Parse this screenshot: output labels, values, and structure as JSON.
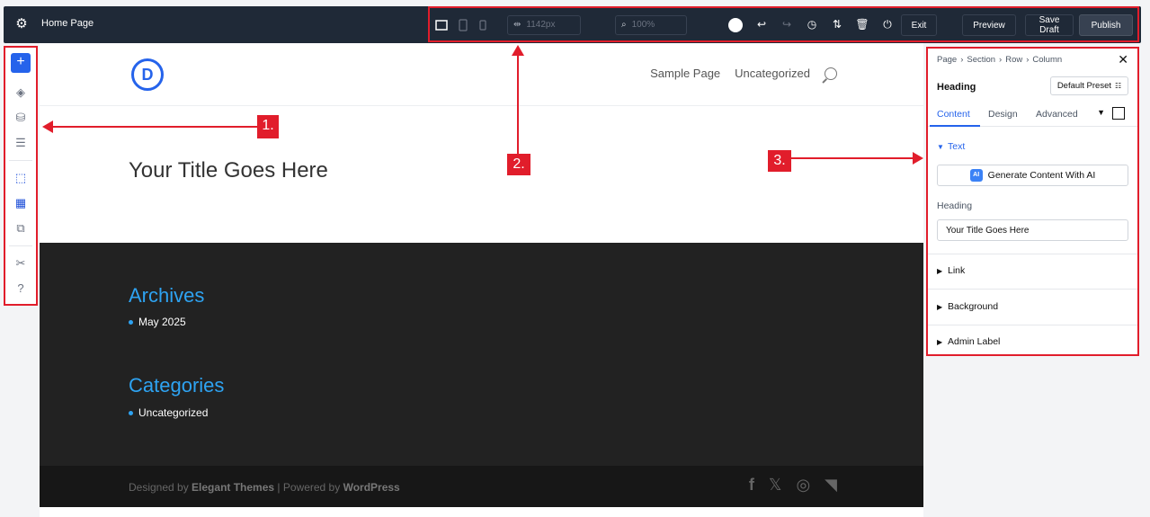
{
  "topbar": {
    "page_name": "Home Page",
    "width_value": "1142px",
    "zoom_value": "100%",
    "exit_label": "Exit",
    "preview_label": "Preview",
    "save_draft_line1": "Save",
    "save_draft_line2": "Draft",
    "publish_label": "Publish"
  },
  "site": {
    "logo_letter": "D",
    "nav": [
      "Sample Page",
      "Uncategorized"
    ],
    "title": "Your Title Goes Here",
    "archives_heading": "Archives",
    "archives_items": [
      "May 2025"
    ],
    "categories_heading": "Categories",
    "categories_items": [
      "Uncategorized"
    ],
    "footer_prefix": "Designed by ",
    "footer_brand": "Elegant Themes",
    "footer_mid": " | Powered by ",
    "footer_wp": "WordPress"
  },
  "panel": {
    "breadcrumb": [
      "Page",
      "Section",
      "Row",
      "Column"
    ],
    "module_name": "Heading",
    "preset_label": "Default Preset",
    "tabs": [
      "Content",
      "Design",
      "Advanced"
    ],
    "text_section": "Text",
    "generate_label": "Generate Content With AI",
    "ai_badge": "AI",
    "heading_label": "Heading",
    "heading_value": "Your Title Goes Here",
    "sections": [
      "Link",
      "Background",
      "Admin Label"
    ]
  },
  "annotations": {
    "label1": "1.",
    "label2": "2.",
    "label3": "3."
  },
  "colors": {
    "accent": "#2563eb",
    "annotation_red": "#e11d2b",
    "link_blue": "#2ea3f2",
    "topbar_bg": "#1f2937"
  }
}
